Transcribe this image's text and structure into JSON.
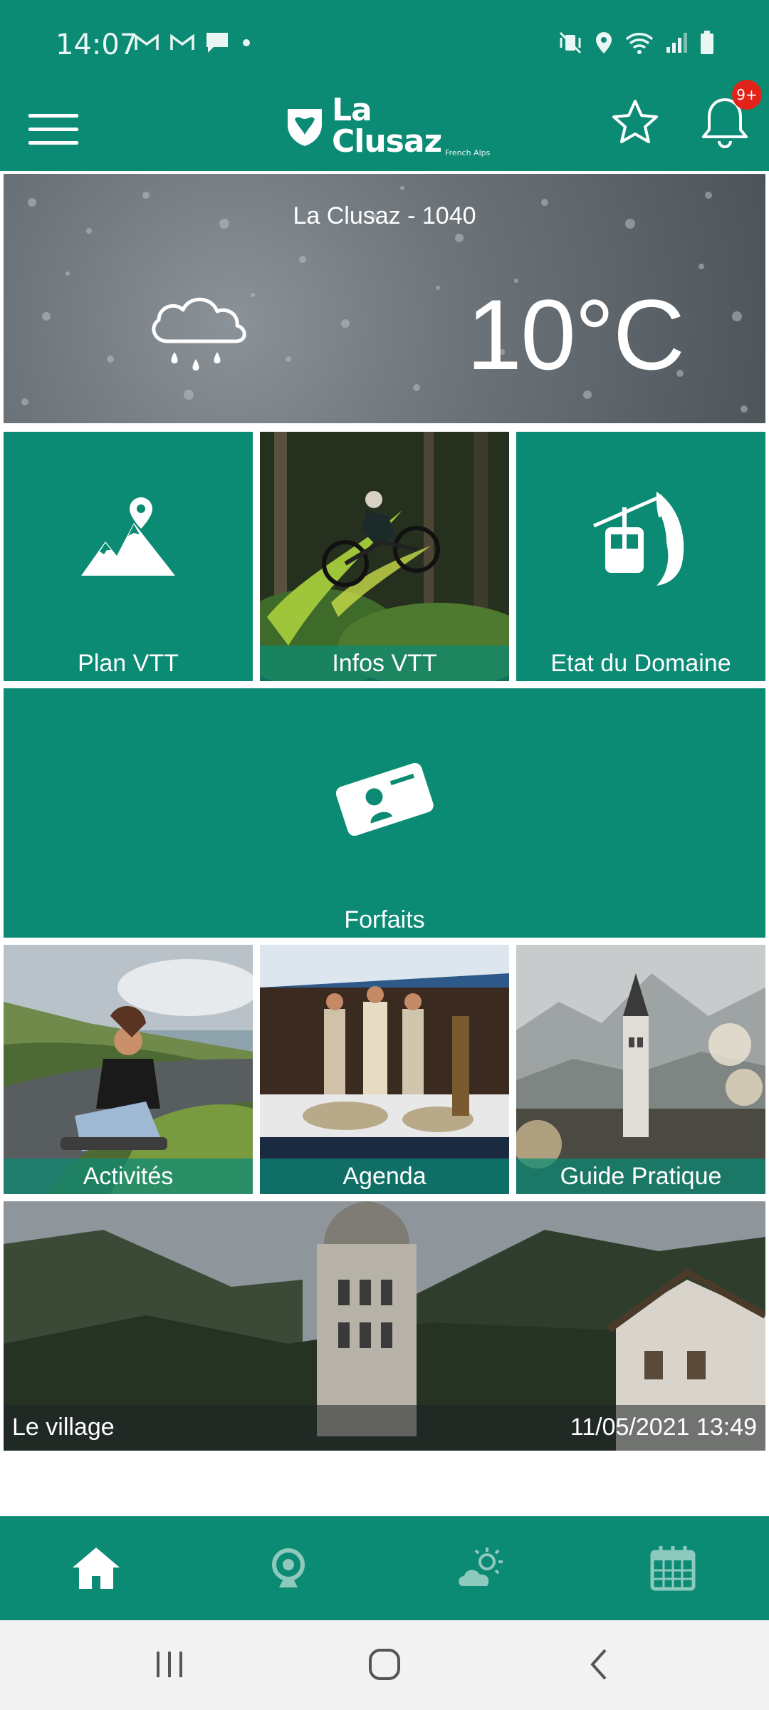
{
  "status_bar": {
    "time": "14:07",
    "left_icons": [
      "gmail-icon",
      "gmail-icon",
      "message-icon",
      "dot-icon"
    ],
    "right_icons": [
      "mute-vibrate-icon",
      "location-icon",
      "wifi-icon",
      "signal-icon",
      "battery-icon"
    ]
  },
  "header": {
    "brand": "La Clusaz",
    "brand_sub": "French Alps",
    "notification_badge": "9+",
    "color": "#0b8a74"
  },
  "weather": {
    "location": "La Clusaz - 1040",
    "temperature": "10°C",
    "condition_icon": "rain-cloud-icon"
  },
  "tiles": {
    "plan_vtt": "Plan VTT",
    "infos_vtt": "Infos VTT",
    "etat_domaine": "Etat du Domaine",
    "forfaits": "Forfaits",
    "activites": "Activités",
    "agenda": "Agenda",
    "guide_pratique": "Guide Pratique"
  },
  "village": {
    "title": "Le village",
    "datetime": "11/05/2021 13:49"
  },
  "bottom_nav": {
    "items": [
      "home-icon",
      "webcam-icon",
      "weather-icon",
      "calendar-icon"
    ],
    "active": "home-icon"
  },
  "system_nav": [
    "recent-apps-icon",
    "home-circle-icon",
    "back-icon"
  ]
}
